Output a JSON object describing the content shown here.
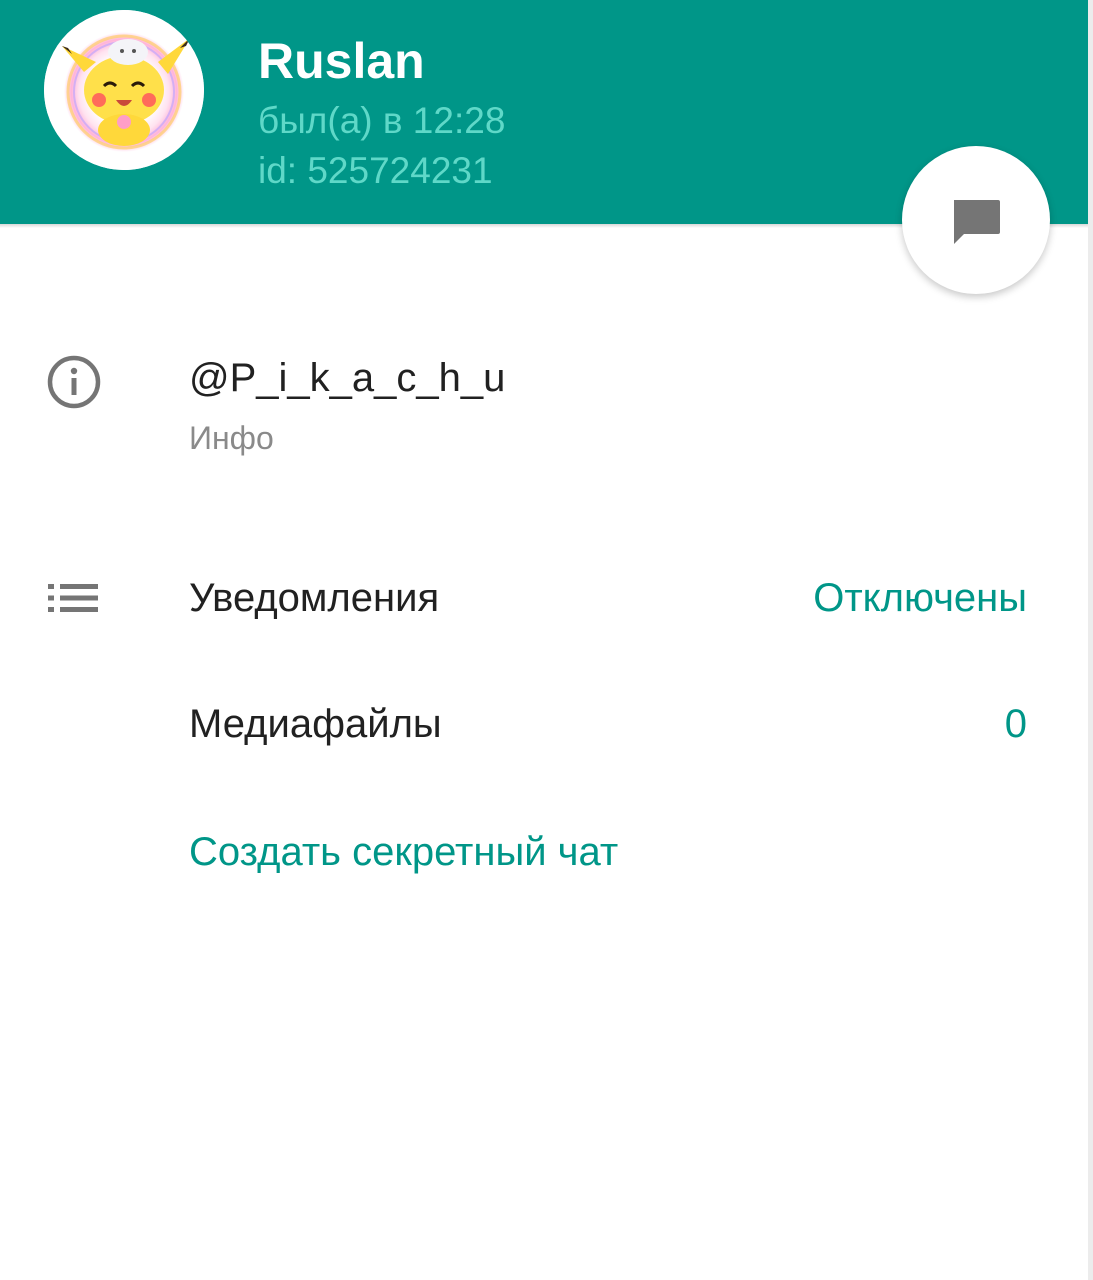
{
  "header": {
    "name": "Ruslan",
    "status": "был(а) в 12:28",
    "user_id": "id: 525724231",
    "background_color": "#009688",
    "avatar_icon": "pikachu-avatar"
  },
  "fab": {
    "icon": "chat-bubble-icon"
  },
  "info": {
    "icon": "info-icon",
    "username": "@P_i_k_a_c_h_u",
    "label": "Инфо"
  },
  "notifications": {
    "icon": "list-icon",
    "label": "Уведомления",
    "value": "Отключены"
  },
  "media": {
    "label": "Медиафайлы",
    "value": "0"
  },
  "secret_chat": {
    "label": "Создать секретный чат"
  },
  "colors": {
    "accent": "#009688",
    "status_text": "#5fd8c8",
    "primary_text": "#212121",
    "secondary_text": "#8a8a8a"
  }
}
